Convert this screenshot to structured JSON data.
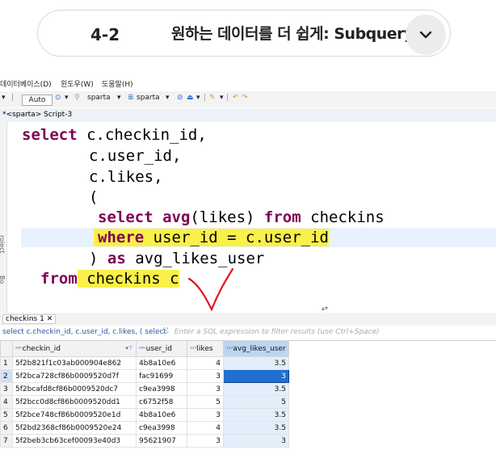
{
  "lesson": {
    "number": "4-2",
    "title": "원하는 데이터를 더 쉽게: Subquery"
  },
  "menubar": {
    "items": [
      "데이터베이스(D)",
      "윈도우(W)",
      "도움말(H)"
    ]
  },
  "toolbar": {
    "auto": "Auto",
    "schema1": "sparta",
    "schema2": "sparta"
  },
  "tabbar": {
    "script_tab": "*<sparta> Script-3"
  },
  "editor": {
    "lines": [
      [
        "select",
        " c.checkin_id,"
      ],
      [
        "",
        "c.user_id,"
      ],
      [
        "",
        "c.likes,"
      ],
      [
        "",
        "("
      ],
      [
        "select",
        " avg",
        "(likes) ",
        "from",
        " checkins"
      ],
      [
        "where",
        " user_id = c.user_id"
      ],
      [
        ") ",
        "as",
        " avg_likes_user"
      ],
      [
        "from",
        " checkins c"
      ]
    ]
  },
  "sidebar": {
    "side_labels": [
      "roject",
      "Bo"
    ]
  },
  "results": {
    "tab_label": "checkins 1",
    "filter_query": "select c.checkin_id, c.user_id, c.likes, ( select",
    "filter_placeholder": "Enter a SQL expression to filter results (use Ctrl+Space)",
    "columns": [
      "checkin_id",
      "user_id",
      "likes",
      "avg_likes_user"
    ],
    "rows": [
      [
        "1",
        "5f2b821f1c03ab000904e862",
        "4b8a10e6",
        "4",
        "3.5"
      ],
      [
        "2",
        "5f2bca728cf86b0009520d7f",
        "fac91699",
        "3",
        "3"
      ],
      [
        "3",
        "5f2bcafd8cf86b0009520dc7",
        "c9ea3998",
        "3",
        "3.5"
      ],
      [
        "4",
        "5f2bcc0d8cf86b0009520dd1",
        "c6752f58",
        "5",
        "5"
      ],
      [
        "5",
        "5f2bce748cf86b0009520e1d",
        "4b8a10e6",
        "3",
        "3.5"
      ],
      [
        "6",
        "5f2bd2368cf86b0009520e24",
        "c9ea3998",
        "4",
        "3.5"
      ],
      [
        "7",
        "5f2beb3cb63cef00093e40d3",
        "95621907",
        "3",
        "3"
      ]
    ]
  },
  "colors": {
    "keyword": "#7f0055",
    "highlight": "#f9f04a",
    "annotation": "#e0161b",
    "selection": "#1f6fd1"
  }
}
